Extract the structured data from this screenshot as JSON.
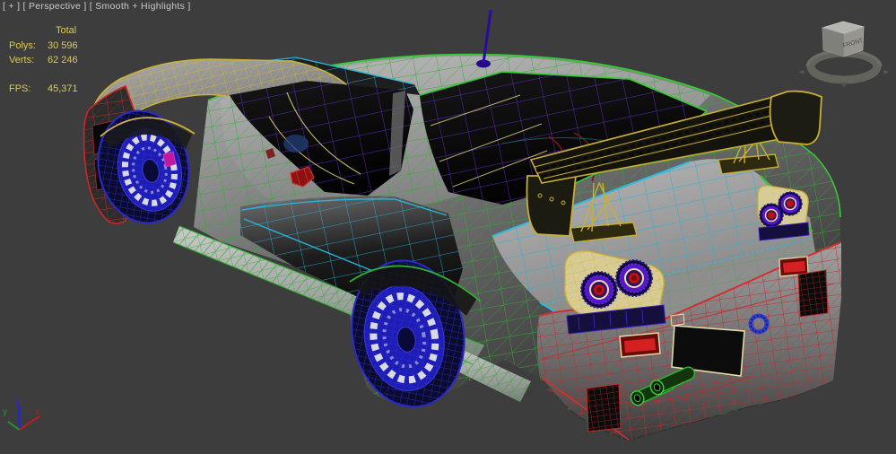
{
  "viewport": {
    "label": "[ + ] [ Perspective ] [ Smooth + Highlights ]",
    "stats": {
      "total_header": "Total",
      "polys_label": "Polys:",
      "polys_value": "30 596",
      "verts_label": "Verts:",
      "verts_value": "62 246",
      "fps_label": "FPS:",
      "fps_value": "45,371"
    },
    "axis_gizmo": {
      "x_label": "x",
      "y_label": "y",
      "z_label": "z"
    },
    "viewcube": {
      "front_label": "FRONT"
    },
    "colors": {
      "background": "#3d3d3d",
      "stats_text": "#dbc95a",
      "label_text": "#c9c9c9",
      "wire_green": "#35c035",
      "wire_cyan": "#28b2d8",
      "wire_yellow": "#cdb23a",
      "wire_red": "#c82828",
      "wire_blue": "#2a2ac8",
      "wire_purple": "#6a2fd2",
      "tail_light_purple": "#5517c8",
      "tail_light_red": "#bb1111",
      "axis_x": "#b02020",
      "axis_y": "#1f9e1f",
      "axis_z": "#2828c8"
    }
  }
}
